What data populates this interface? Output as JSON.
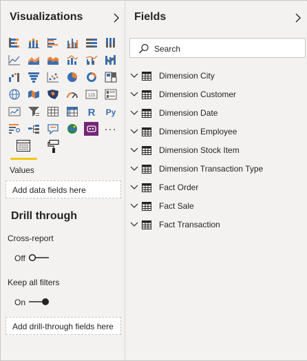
{
  "visualizations_pane": {
    "title": "Visualizations",
    "collapse_icon": "chevron-right-icon",
    "visual_types": [
      {
        "icon": "stacked-bar-chart-icon"
      },
      {
        "icon": "stacked-column-chart-icon"
      },
      {
        "icon": "clustered-bar-chart-icon"
      },
      {
        "icon": "clustered-column-chart-icon"
      },
      {
        "icon": "100-stacked-bar-chart-icon"
      },
      {
        "icon": "100-stacked-column-chart-icon"
      },
      {
        "icon": "line-chart-icon"
      },
      {
        "icon": "area-chart-icon"
      },
      {
        "icon": "stacked-area-chart-icon"
      },
      {
        "icon": "line-and-column-chart-icon"
      },
      {
        "icon": "line-and-clustered-column-chart-icon"
      },
      {
        "icon": "ribbon-chart-icon"
      },
      {
        "icon": "waterfall-chart-icon"
      },
      {
        "icon": "funnel-chart-icon"
      },
      {
        "icon": "scatter-chart-icon"
      },
      {
        "icon": "pie-chart-icon"
      },
      {
        "icon": "donut-chart-icon"
      },
      {
        "icon": "treemap-icon"
      },
      {
        "icon": "map-icon"
      },
      {
        "icon": "filled-map-icon"
      },
      {
        "icon": "shape-map-icon"
      },
      {
        "icon": "gauge-icon"
      },
      {
        "icon": "card-icon",
        "text": "123"
      },
      {
        "icon": "multi-row-card-icon"
      },
      {
        "icon": "kpi-icon"
      },
      {
        "icon": "slicer-icon"
      },
      {
        "icon": "table-icon"
      },
      {
        "icon": "matrix-icon"
      },
      {
        "icon": "r-visual-icon",
        "text": "R"
      },
      {
        "icon": "python-visual-icon",
        "text": "Py"
      },
      {
        "icon": "key-influencers-icon"
      },
      {
        "icon": "decomposition-tree-icon"
      },
      {
        "icon": "qa-icon"
      },
      {
        "icon": "arcgis-map-icon"
      },
      {
        "icon": "power-apps-icon"
      },
      {
        "icon": "more-options-icon",
        "text": "···"
      }
    ],
    "tabs": [
      {
        "icon": "fields-tab-icon",
        "active": true
      },
      {
        "icon": "format-paint-roller-icon",
        "active": false
      }
    ],
    "values_label": "Values",
    "values_placeholder": "Add data fields here",
    "drill_through": {
      "title": "Drill through",
      "cross_report": {
        "label": "Cross-report",
        "state": "Off"
      },
      "keep_all_filters": {
        "label": "Keep all filters",
        "state": "On"
      },
      "placeholder": "Add drill-through fields here"
    }
  },
  "fields_pane": {
    "title": "Fields",
    "collapse_icon": "chevron-right-icon",
    "search": {
      "placeholder": "Search",
      "icon": "search-icon"
    },
    "tables": [
      {
        "name": "Dimension City"
      },
      {
        "name": "Dimension Customer"
      },
      {
        "name": "Dimension Date"
      },
      {
        "name": "Dimension Employee"
      },
      {
        "name": "Dimension Stock Item"
      },
      {
        "name": "Dimension Transaction Type"
      },
      {
        "name": "Fact Order"
      },
      {
        "name": "Fact Sale"
      },
      {
        "name": "Fact Transaction"
      }
    ]
  },
  "colors": {
    "accent_yellow": "#f2c811",
    "icon_orange": "#e8803a",
    "icon_blue": "#3a6fb0",
    "icon_navy": "#2b3f66",
    "icon_gray": "#605e5c",
    "power_apps_purple": "#742774"
  }
}
